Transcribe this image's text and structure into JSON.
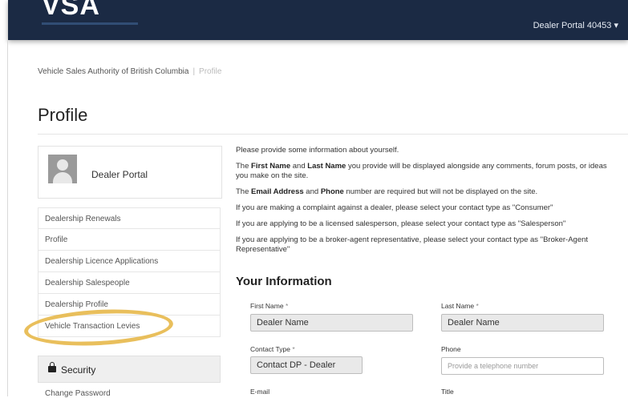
{
  "header": {
    "logo_text": "VSA",
    "portal_menu": "Dealer Portal 40453 ▾"
  },
  "breadcrumb": {
    "root": "Vehicle Sales Authority of British Columbia",
    "separator": "|",
    "current": "Profile"
  },
  "page_title": "Profile",
  "sidebar": {
    "profile_name": "Dealer Portal",
    "items": [
      {
        "label": "Dealership Renewals"
      },
      {
        "label": "Profile"
      },
      {
        "label": "Dealership Licence Applications"
      },
      {
        "label": "Dealership Salespeople"
      },
      {
        "label": "Dealership Profile"
      },
      {
        "label": "Vehicle Transaction Levies"
      }
    ],
    "security_label": "Security",
    "change_password": "Change Password"
  },
  "intro": {
    "p1": "Please provide some information about yourself.",
    "p2_a": "The ",
    "p2_b1": "First Name",
    "p2_c": " and ",
    "p2_b2": "Last Name",
    "p2_d": " you provide will be displayed alongside any comments, forum posts, or ideas you make on the site.",
    "p3_a": "The ",
    "p3_b1": "Email Address",
    "p3_c": " and ",
    "p3_b2": "Phone",
    "p3_d": " number are required but will not be displayed on the site.",
    "p4": "If you are making a complaint against a dealer, please select your contact type as \"Consumer\"",
    "p5": "If you are applying to be a licensed salesperson, please select your contact type as \"Salesperson\"",
    "p6": "If you are applying to be a broker-agent representative, please select your contact type as \"Broker-Agent Representative\""
  },
  "form": {
    "section_title": "Your Information",
    "first_name_label": "First Name",
    "first_name_value": "Dealer Name",
    "last_name_label": "Last Name",
    "last_name_value": "Dealer Name",
    "contact_type_label": "Contact Type",
    "contact_type_value": "Contact DP - Dealer",
    "phone_label": "Phone",
    "phone_placeholder": "Provide a telephone number",
    "email_label": "E-mail",
    "title_label": "Title",
    "required_mark": "*"
  },
  "colors": {
    "navbar": "#1b2a44",
    "highlight": "#e7b84a"
  }
}
